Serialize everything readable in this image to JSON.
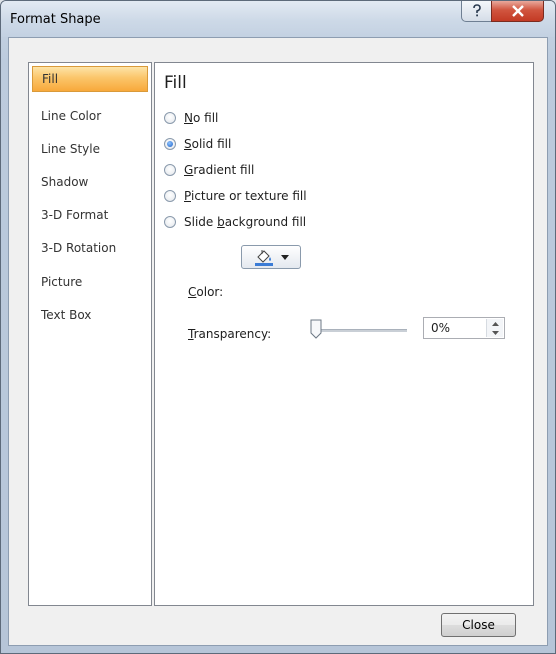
{
  "window": {
    "title": "Format Shape"
  },
  "nav": {
    "items": [
      {
        "label": "Fill",
        "selected": true
      },
      {
        "label": "Line Color",
        "selected": false
      },
      {
        "label": "Line Style",
        "selected": false
      },
      {
        "label": "Shadow",
        "selected": false
      },
      {
        "label": "3-D Format",
        "selected": false
      },
      {
        "label": "3-D Rotation",
        "selected": false
      },
      {
        "label": "Picture",
        "selected": false
      },
      {
        "label": "Text Box",
        "selected": false
      }
    ]
  },
  "fill": {
    "heading": "Fill",
    "options": [
      {
        "label": "No fill",
        "accel": "N",
        "checked": false
      },
      {
        "label": "Solid fill",
        "accel": "S",
        "checked": true
      },
      {
        "label": "Gradient fill",
        "accel": "G",
        "checked": false
      },
      {
        "label": "Picture or texture fill",
        "accel": "P",
        "checked": false
      },
      {
        "label": "Slide background fill",
        "accel": "b",
        "checked": false
      }
    ],
    "color_label": "Color:",
    "transparency_label": "Transparency:",
    "transparency_value": "0%",
    "transparency_fraction": 0
  },
  "buttons": {
    "close": "Close"
  },
  "colors": {
    "accent": "#1b5fc6",
    "selected_nav": "#fbc56a",
    "fill_swatch": "#3b7cd6"
  }
}
